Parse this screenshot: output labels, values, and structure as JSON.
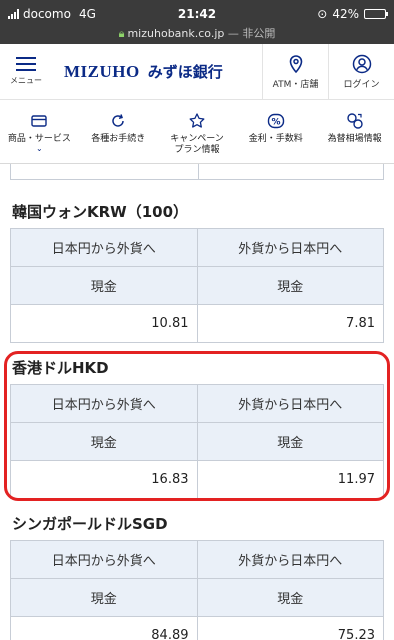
{
  "status_bar": {
    "carrier": "docomo",
    "network": "4G",
    "time": "21:42",
    "battery": "42%",
    "battery_level": 0.42
  },
  "url_bar": {
    "domain": "mizuhobank.co.jp",
    "suffix": "— 非公開"
  },
  "header": {
    "menu_label": "メニュー",
    "logo_en": "MIZUHO",
    "logo_ja": "みずほ銀行",
    "atm_label": "ATM・店舗",
    "login_label": "ログイン",
    "brand_color": "#0b2a86"
  },
  "nav": {
    "items": [
      {
        "label": "商品・サービス",
        "icon": "wallet-icon",
        "chevron": "⌄"
      },
      {
        "label": "各種お手続き",
        "icon": "refresh-icon"
      },
      {
        "label": "キャンペーン\nプラン情報",
        "icon": "star-icon"
      },
      {
        "label": "金利・手数料",
        "icon": "percent-icon"
      },
      {
        "label": "為替相場情報",
        "icon": "currency-exchange-icon"
      }
    ]
  },
  "sections": [
    {
      "title": "韓国ウォンKRW（100）",
      "col1": "日本円から外貨へ",
      "col2": "外貨から日本円へ",
      "sub1": "現金",
      "sub2": "現金",
      "val1": "10.81",
      "val2": "7.81"
    },
    {
      "title": "香港ドルHKD",
      "col1": "日本円から外貨へ",
      "col2": "外貨から日本円へ",
      "sub1": "現金",
      "sub2": "現金",
      "val1": "16.83",
      "val2": "11.97"
    },
    {
      "title": "シンガポールドルSGD",
      "col1": "日本円から外貨へ",
      "col2": "外貨から日本円へ",
      "sub1": "現金",
      "sub2": "現金",
      "val1": "84.89",
      "val2": "75.23"
    }
  ],
  "colors": {
    "highlight": "#e32222",
    "table_header": "#eaf0f8",
    "table_border": "#c7cdd6"
  }
}
